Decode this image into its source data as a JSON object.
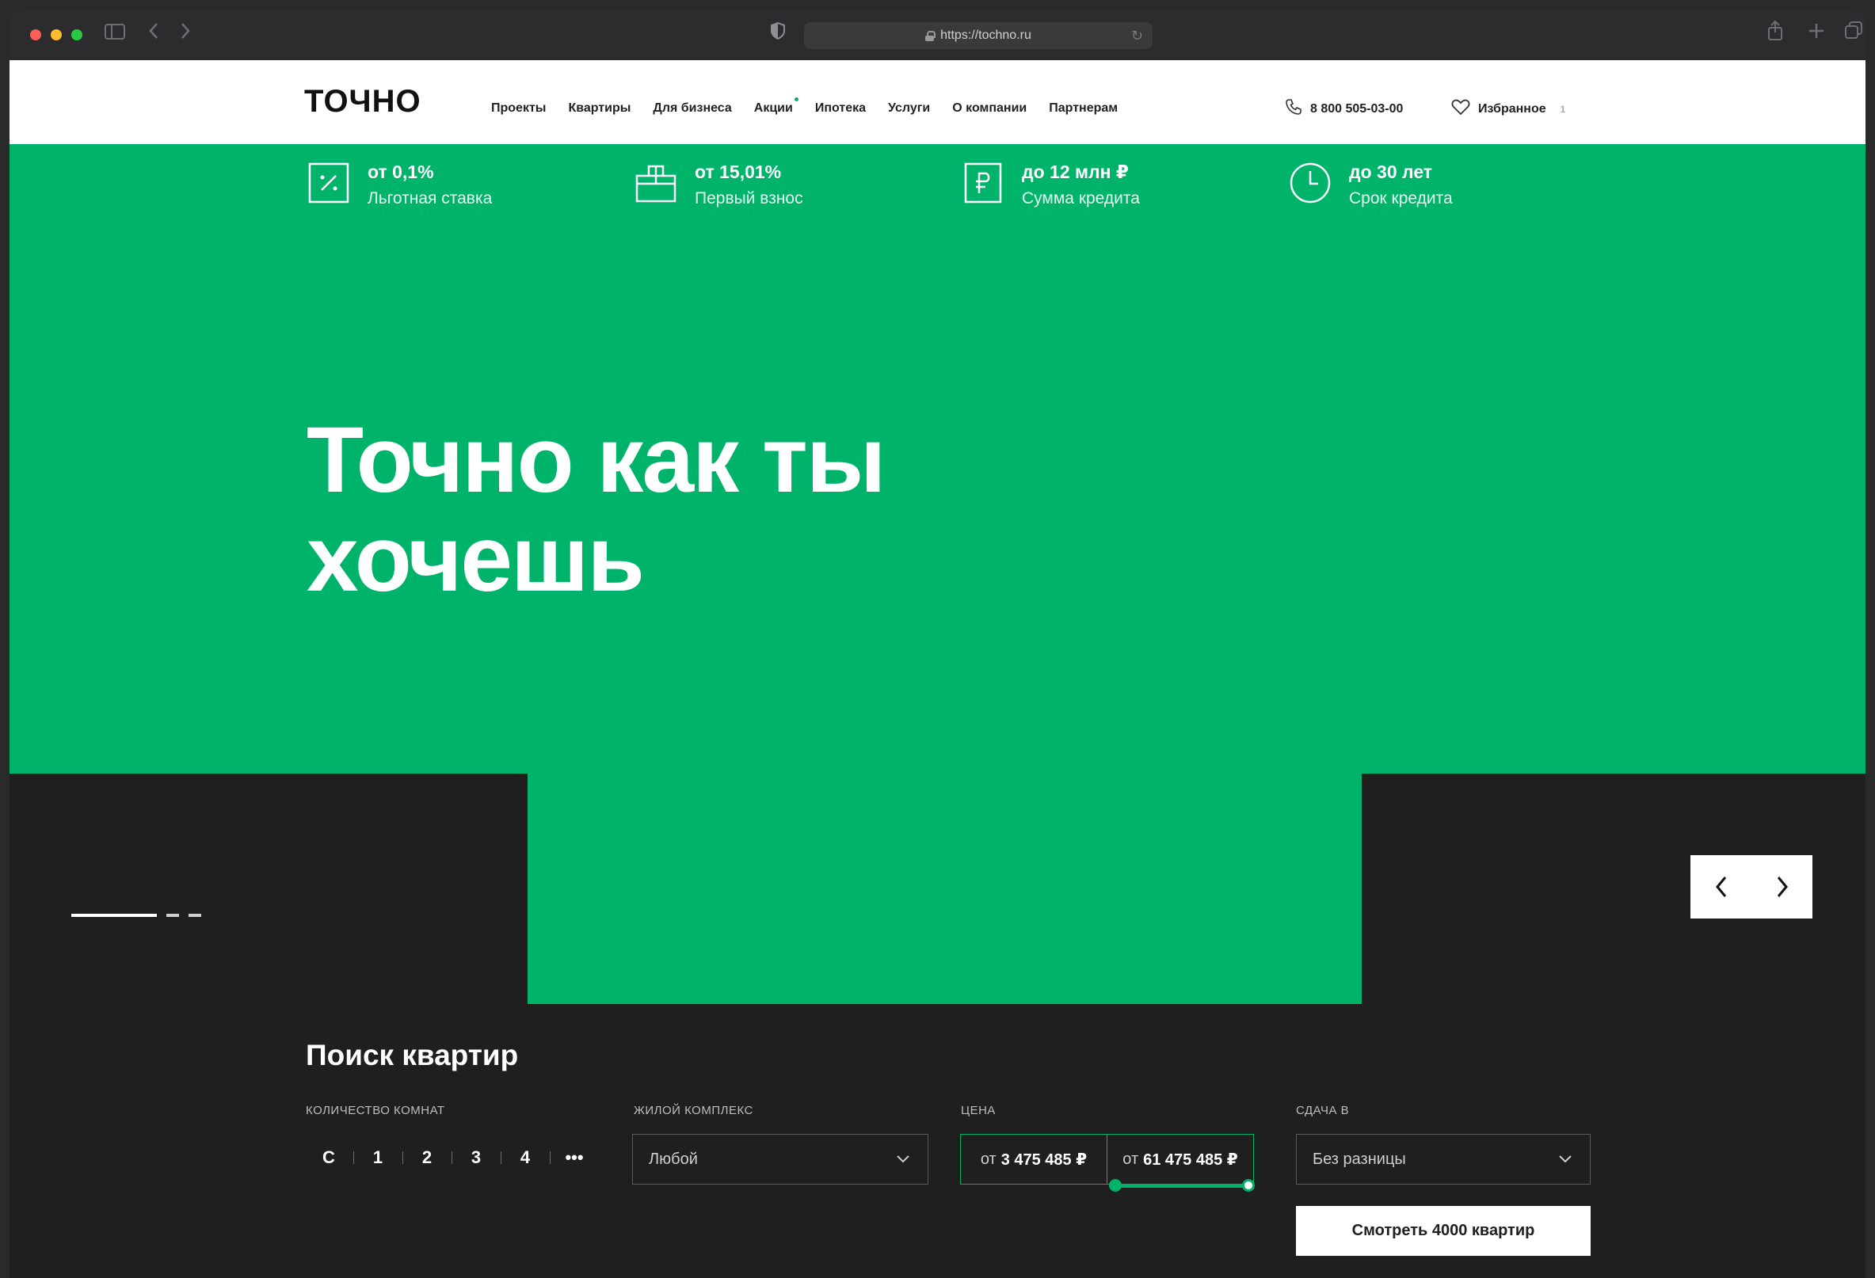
{
  "browser": {
    "url": "https://tochno.ru"
  },
  "header": {
    "logo": "ТОЧНО",
    "nav": [
      {
        "label": "Проекты"
      },
      {
        "label": "Квартиры"
      },
      {
        "label": "Для бизнеса"
      },
      {
        "label": "Акции"
      },
      {
        "label": "Ипотека"
      },
      {
        "label": "Услуги"
      },
      {
        "label": "О компании"
      },
      {
        "label": "Партнерам"
      }
    ],
    "phone": "8 800 505-03-00",
    "favorites_label": "Избранное",
    "favorites_count": "1"
  },
  "hero": {
    "benefits": [
      {
        "value": "от 0,1%",
        "label": "Льготная ставка",
        "icon": "percent-icon"
      },
      {
        "value": "от 15,01%",
        "label": "Первый взнос",
        "icon": "bag-icon"
      },
      {
        "value": "до 12 млн ₽",
        "label": "Сумма кредита",
        "icon": "ruble-icon"
      },
      {
        "value": "до 30 лет",
        "label": "Срок кредита",
        "icon": "clock-icon"
      }
    ],
    "title_line1": "Точно как ты",
    "title_line2": "хочешь"
  },
  "search": {
    "title": "Поиск квартир",
    "rooms_label": "Количество комнат",
    "rooms": [
      "С",
      "1",
      "2",
      "3",
      "4",
      "•••"
    ],
    "complex_label": "Жилой комплекс",
    "complex_value": "Любой",
    "price_label": "Цена",
    "price_from_prefix": "от",
    "price_from": "3 475 485 ₽",
    "price_to_prefix": "от",
    "price_to": "61 475 485 ₽",
    "delivery_label": "Сдача в",
    "delivery_value": "Без разницы",
    "submit_label": "Смотреть 4000 квартир"
  },
  "colors": {
    "brand_green": "#00b36b",
    "dark_bg": "#1f1f1f"
  }
}
